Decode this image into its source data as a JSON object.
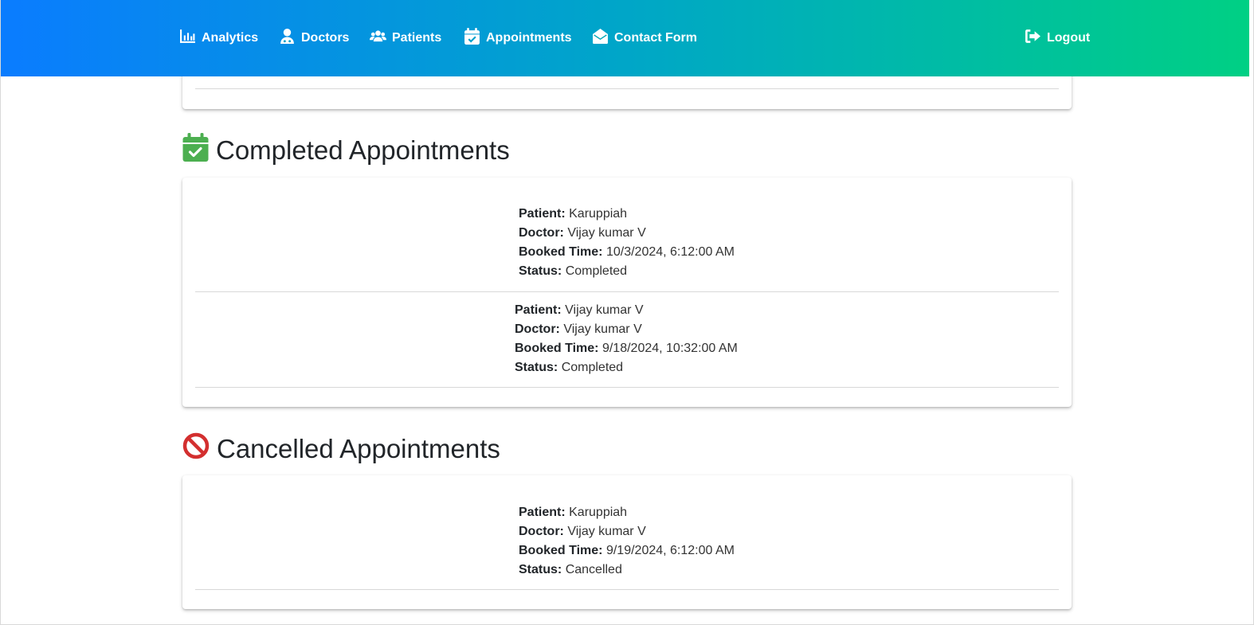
{
  "nav": {
    "items": [
      {
        "label": "Analytics",
        "icon": "chart-bar-icon"
      },
      {
        "label": "Doctors",
        "icon": "user-doctor-icon"
      },
      {
        "label": "Patients",
        "icon": "users-icon"
      },
      {
        "label": "Appointments",
        "icon": "calendar-check-icon"
      },
      {
        "label": "Contact Form",
        "icon": "envelope-open-icon"
      }
    ],
    "logout": {
      "label": "Logout",
      "icon": "sign-out-icon"
    }
  },
  "colors": {
    "gradient_start": "#0a7cff",
    "gradient_end": "#00d084",
    "completed_icon": "#4caf50",
    "cancelled_icon": "#d32f2f"
  },
  "labels": {
    "patient": "Patient:",
    "doctor": "Doctor:",
    "booked_time": "Booked Time:",
    "status": "Status:"
  },
  "completed": {
    "title": "Completed Appointments",
    "icon": "calendar-check-icon",
    "appointments": [
      {
        "patient": "Karuppiah",
        "doctor": "Vijay kumar V",
        "booked_time": "10/3/2024, 6:12:00 AM",
        "status": "Completed"
      },
      {
        "patient": "Vijay kumar V",
        "doctor": "Vijay kumar V",
        "booked_time": "9/18/2024, 10:32:00 AM",
        "status": "Completed"
      }
    ]
  },
  "cancelled": {
    "title": "Cancelled Appointments",
    "icon": "ban-icon",
    "appointments": [
      {
        "patient": "Karuppiah",
        "doctor": "Vijay kumar V",
        "booked_time": "9/19/2024, 6:12:00 AM",
        "status": "Cancelled"
      }
    ]
  }
}
